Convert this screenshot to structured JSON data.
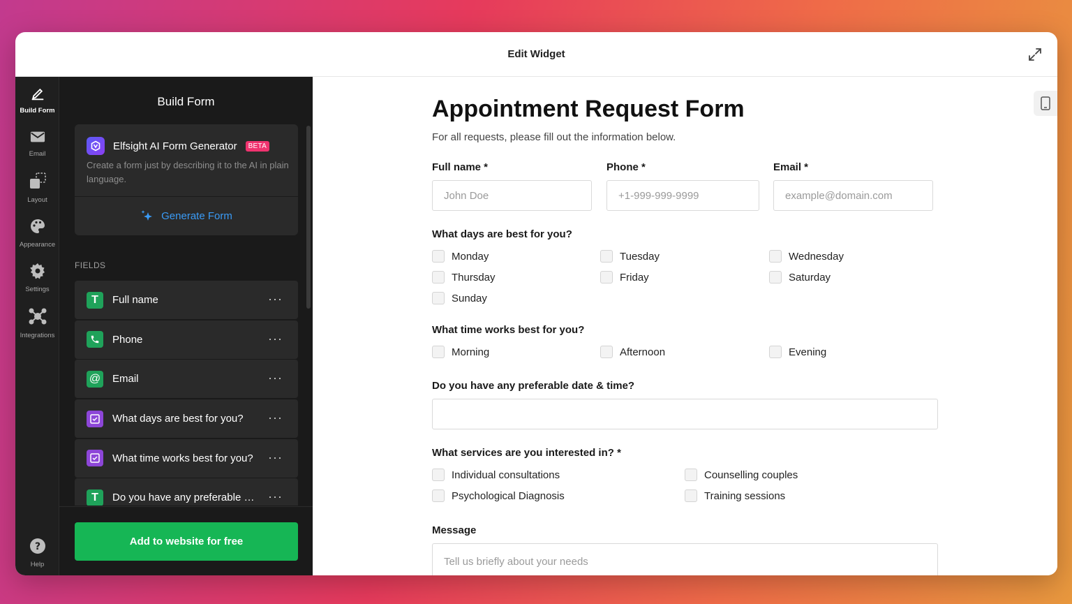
{
  "window": {
    "title": "Edit Widget"
  },
  "rail": {
    "items": [
      {
        "label": "Build Form",
        "icon": "pencil-icon"
      },
      {
        "label": "Email",
        "icon": "mail-icon"
      },
      {
        "label": "Layout",
        "icon": "layout-icon"
      },
      {
        "label": "Appearance",
        "icon": "palette-icon"
      },
      {
        "label": "Settings",
        "icon": "gear-icon"
      },
      {
        "label": "Integrations",
        "icon": "integrations-icon"
      }
    ],
    "help": "Help"
  },
  "panel": {
    "title": "Build Form",
    "ai": {
      "name": "Elfsight AI Form Generator",
      "badge": "BETA",
      "description": "Create a form just by describing it to the AI in plain language.",
      "button": "Generate Form"
    },
    "fields_label": "FIELDS",
    "fields": [
      {
        "name": "Full name",
        "icon": "text-icon",
        "glyph": "T"
      },
      {
        "name": "Phone",
        "icon": "phone-icon",
        "glyph": ""
      },
      {
        "name": "Email",
        "icon": "at-icon",
        "glyph": "@"
      },
      {
        "name": "What days are best for you?",
        "icon": "checkbox-icon",
        "glyph": ""
      },
      {
        "name": "What time works best for you?",
        "icon": "checkbox-icon",
        "glyph": ""
      },
      {
        "name": "Do you have any preferable date & time?",
        "icon": "text-icon",
        "glyph": "T"
      }
    ],
    "more": "···",
    "add_button": "Add to website for free"
  },
  "form": {
    "title": "Appointment Request Form",
    "subtitle": "For all requests, please fill out the information below.",
    "full_name": {
      "label": "Full name *",
      "placeholder": "John Doe"
    },
    "phone": {
      "label": "Phone *",
      "placeholder": "+1-999-999-9999"
    },
    "email": {
      "label": "Email *",
      "placeholder": "example@domain.com"
    },
    "days": {
      "label": "What days are best for you?",
      "options": [
        "Monday",
        "Tuesday",
        "Wednesday",
        "Thursday",
        "Friday",
        "Saturday",
        "Sunday"
      ]
    },
    "time": {
      "label": "What time works best for you?",
      "options": [
        "Morning",
        "Afternoon",
        "Evening"
      ]
    },
    "preferable": {
      "label": "Do you have any preferable date & time?",
      "value": ""
    },
    "services": {
      "label": "What services are you interested in? *",
      "options": [
        "Individual consultations",
        "Counselling couples",
        "Psychological Diagnosis",
        "Training sessions"
      ]
    },
    "message": {
      "label": "Message",
      "placeholder": "Tell us briefly about your needs"
    }
  },
  "colors": {
    "accent_blue": "#3a9bf6",
    "add_green": "#16b655",
    "beta_pink": "#f0336f",
    "panel_bg": "#1a1a1a"
  }
}
